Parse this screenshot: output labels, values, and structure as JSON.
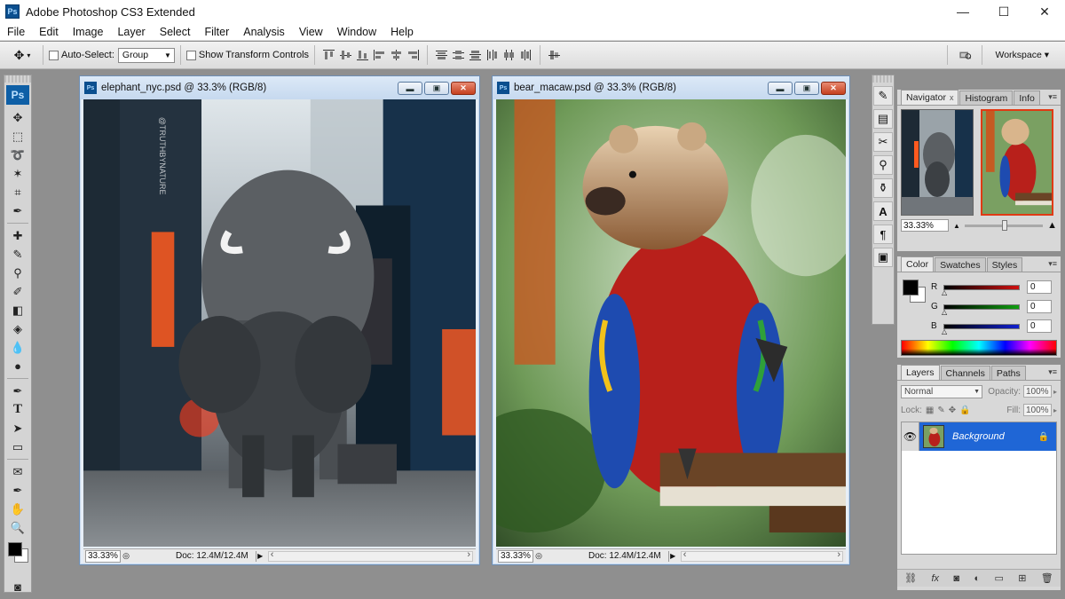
{
  "app": {
    "title": "Adobe Photoshop CS3 Extended",
    "icon_text": "Ps",
    "window_controls": {
      "minimize": "—",
      "maximize": "☐",
      "close": "✕"
    }
  },
  "menu": [
    "File",
    "Edit",
    "Image",
    "Layer",
    "Select",
    "Filter",
    "Analysis",
    "View",
    "Window",
    "Help"
  ],
  "options_bar": {
    "auto_select_label": "Auto-Select:",
    "auto_select_value": "Group",
    "show_transform_label": "Show Transform Controls",
    "workspace_label": "Workspace ▾"
  },
  "tools": {
    "logo": "Ps",
    "icons": [
      "move-tool-icon",
      "marquee-tool-icon",
      "lasso-tool-icon",
      "magic-wand-icon",
      "crop-tool-icon",
      "eyedropper-icon",
      "healing-brush-icon",
      "brush-tool-icon",
      "clone-stamp-icon",
      "history-brush-icon",
      "eraser-icon",
      "paint-bucket-icon",
      "blur-tool-icon",
      "dodge-tool-icon",
      "pen-tool-icon",
      "type-tool-icon",
      "path-selection-icon",
      "shape-tool-icon",
      "notes-tool-icon",
      "eyedropper-2-icon",
      "hand-tool-icon",
      "zoom-tool-icon"
    ],
    "glyphs": [
      "✥",
      "⬚",
      "➰",
      "✶",
      "⌗",
      "✒",
      "✚",
      "✎",
      "⚲",
      "✐",
      "◧",
      "◈",
      "💧",
      "●",
      "✒",
      "T",
      "➤",
      "▭",
      "✉",
      "✒",
      "✋",
      "🔍"
    ]
  },
  "documents": [
    {
      "title": "elephant_nyc.psd @ 33.3% (RGB/8)",
      "zoom": "33.33%",
      "doc_info": "Doc: 12.4M/12.4M",
      "watermark": "@TRUTHBYNATURE"
    },
    {
      "title": "bear_macaw.psd @ 33.3% (RGB/8)",
      "zoom": "33.33%",
      "doc_info": "Doc: 12.4M/12.4M"
    }
  ],
  "navigator": {
    "tabs": [
      "Navigator",
      "Histogram",
      "Info"
    ],
    "close_glyph": "x",
    "zoom": "33.33%"
  },
  "color": {
    "tabs": [
      "Color",
      "Swatches",
      "Styles"
    ],
    "channels": [
      {
        "label": "R",
        "value": "0",
        "bar_color": "#d01010"
      },
      {
        "label": "G",
        "value": "0",
        "bar_color": "#10a010"
      },
      {
        "label": "B",
        "value": "0",
        "bar_color": "#1020d0"
      }
    ]
  },
  "layers": {
    "tabs": [
      "Layers",
      "Channels",
      "Paths"
    ],
    "blend_mode": "Normal",
    "opacity_label": "Opacity:",
    "opacity_value": "100%",
    "lock_label": "Lock:",
    "fill_label": "Fill:",
    "fill_value": "100%",
    "items": [
      {
        "name": "Background"
      }
    ],
    "footer_icons": [
      "link-icon",
      "fx-icon",
      "mask-icon",
      "adjustment-icon",
      "folder-icon",
      "new-layer-icon",
      "trash-icon"
    ],
    "footer_glyphs": [
      "⛓",
      "fx",
      "◙",
      "◐",
      "▭",
      "⊞",
      "🗑"
    ]
  },
  "accent_colors": {
    "selection_blue": "#1f66d6",
    "navigator_frame": "#e03a14"
  }
}
